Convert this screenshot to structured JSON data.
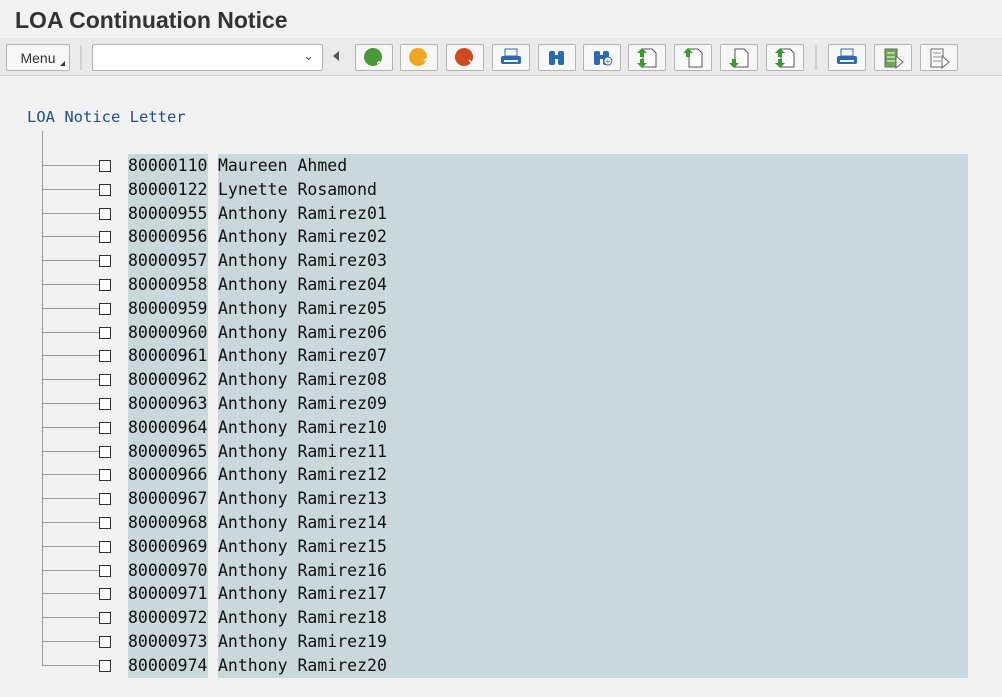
{
  "title": "LOA Continuation Notice",
  "toolbar": {
    "menu_label": "Menu",
    "command_field_value": "",
    "buttons": [
      "back",
      "exit",
      "cancel",
      "print",
      "find",
      "find-next",
      "first-page",
      "previous-page",
      "next-page",
      "last-page",
      "print-list",
      "select-layout",
      "change-layout"
    ]
  },
  "tree": {
    "root_label": "LOA Notice Letter",
    "items": [
      {
        "id": "80000110",
        "name": "Maureen Ahmed"
      },
      {
        "id": "80000122",
        "name": "Lynette Rosamond"
      },
      {
        "id": "80000955",
        "name": "Anthony Ramirez01"
      },
      {
        "id": "80000956",
        "name": "Anthony Ramirez02"
      },
      {
        "id": "80000957",
        "name": "Anthony Ramirez03"
      },
      {
        "id": "80000958",
        "name": "Anthony Ramirez04"
      },
      {
        "id": "80000959",
        "name": "Anthony Ramirez05"
      },
      {
        "id": "80000960",
        "name": "Anthony Ramirez06"
      },
      {
        "id": "80000961",
        "name": "Anthony Ramirez07"
      },
      {
        "id": "80000962",
        "name": "Anthony Ramirez08"
      },
      {
        "id": "80000963",
        "name": "Anthony Ramirez09"
      },
      {
        "id": "80000964",
        "name": "Anthony Ramirez10"
      },
      {
        "id": "80000965",
        "name": "Anthony Ramirez11"
      },
      {
        "id": "80000966",
        "name": "Anthony Ramirez12"
      },
      {
        "id": "80000967",
        "name": "Anthony Ramirez13"
      },
      {
        "id": "80000968",
        "name": "Anthony Ramirez14"
      },
      {
        "id": "80000969",
        "name": "Anthony Ramirez15"
      },
      {
        "id": "80000970",
        "name": "Anthony Ramirez16"
      },
      {
        "id": "80000971",
        "name": "Anthony Ramirez17"
      },
      {
        "id": "80000972",
        "name": "Anthony Ramirez18"
      },
      {
        "id": "80000973",
        "name": "Anthony Ramirez19"
      },
      {
        "id": "80000974",
        "name": "Anthony Ramirez20"
      }
    ]
  }
}
